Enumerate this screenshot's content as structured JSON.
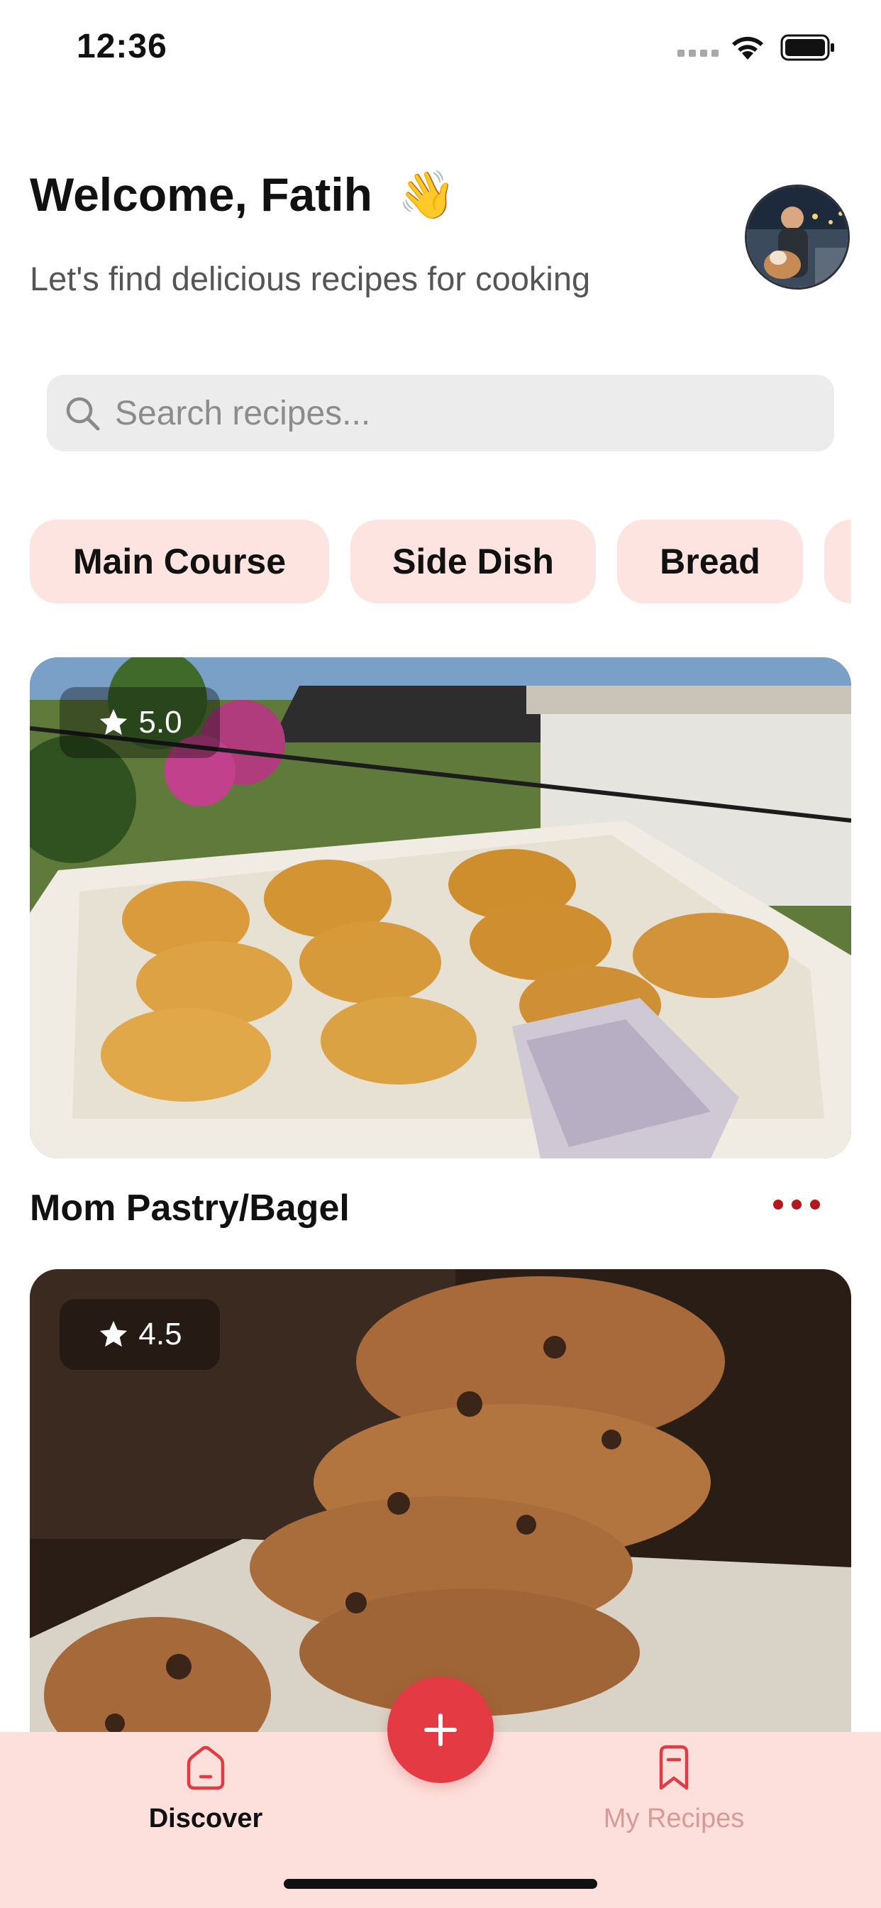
{
  "status_bar": {
    "time": "12:36"
  },
  "header": {
    "welcome": "Welcome, Fatih",
    "wave_emoji": "👋",
    "subtitle": "Let's find delicious recipes for cooking"
  },
  "search": {
    "placeholder": "Search recipes..."
  },
  "categories": [
    "Main Course",
    "Side Dish",
    "Bread",
    ""
  ],
  "recipes": [
    {
      "title": "Mom Pastry/Bagel",
      "rating": "5.0"
    },
    {
      "title": "",
      "rating": "4.5"
    }
  ],
  "tab_bar": {
    "discover_label": "Discover",
    "my_recipes_label": "My Recipes",
    "add_symbol": "+"
  },
  "colors": {
    "accent": "#e33a44",
    "chip_background": "#fde4e0",
    "tab_bar_background": "#fde0dc",
    "more_dots": "#b4151e"
  }
}
